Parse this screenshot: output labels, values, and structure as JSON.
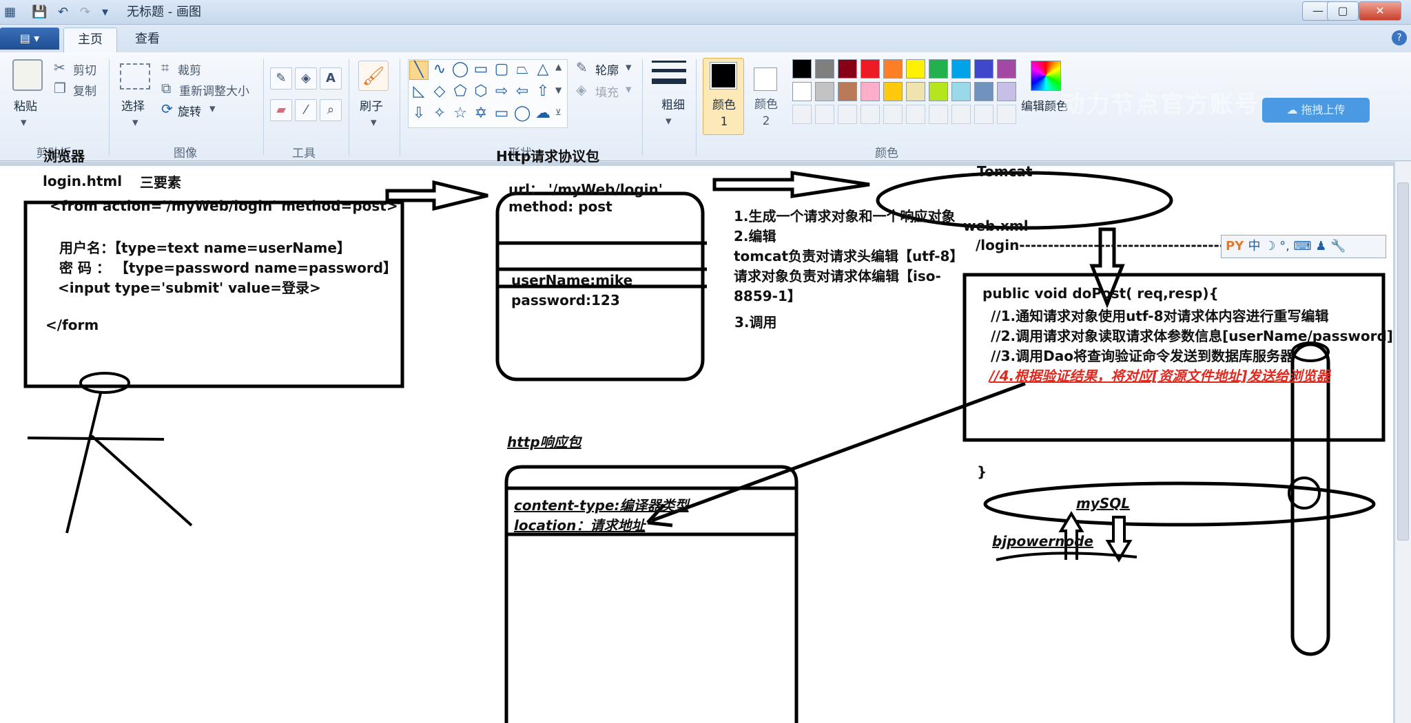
{
  "window": {
    "title": "无标题 - 画图",
    "buttons": {
      "minimize": "—",
      "maximize": "▢",
      "close": "✕"
    }
  },
  "quick_access": {
    "save": "💾",
    "undo": "↶",
    "redo": "↷",
    "customize": "▾"
  },
  "tabs": {
    "file": "▤ ▾",
    "home": "主页",
    "view": "查看",
    "help": "?"
  },
  "ribbon": {
    "clipboard": {
      "label": "剪贴板",
      "paste": "粘贴",
      "cut": "剪切",
      "copy": "复制"
    },
    "image": {
      "label": "图像",
      "select": "选择",
      "crop": "裁剪",
      "resize": "重新调整大小",
      "rotate": "旋转"
    },
    "tools": {
      "label": "工具"
    },
    "brush": {
      "label": "刷子"
    },
    "shapes": {
      "label": "形状",
      "outline": "轮廓",
      "fill": "填充"
    },
    "size": {
      "label": "粗细"
    },
    "colors": {
      "label": "颜色",
      "color1": "颜色 1",
      "color2": "颜色 2",
      "edit": "编辑颜色",
      "row1": [
        "#000000",
        "#7f7f7f",
        "#880015",
        "#ed1c24",
        "#ff7f27",
        "#fff200",
        "#22b14c",
        "#00a2e8",
        "#3f48cc",
        "#a349a4"
      ],
      "row2": [
        "#ffffff",
        "#c3c3c3",
        "#b97a57",
        "#ffaec9",
        "#ffc90e",
        "#efe4b0",
        "#b5e61d",
        "#99d9ea",
        "#7092be",
        "#c8bfe7"
      ]
    },
    "upload": "拖拽上传",
    "watermark": "动力节点官方账号"
  },
  "ime": "中 ☽ °, ⌨ ♟ 🔧",
  "canvas": {
    "browser_title": "浏览器",
    "login_html": "login.html",
    "three_elements": "三要素",
    "form_open": "<from action='/myWeb/login' method=post>",
    "username_field": "用户名：【type=text  name=userName】",
    "password_field": "密  码 ：  【type=password name=password】",
    "submit_field": "<input type='submit' value=登录>",
    "form_close": "</form",
    "http_request_title": "Http请求协议包",
    "req_url": "url：  '/myWeb/login'",
    "req_method": "method: post",
    "req_user": "userName:mike",
    "req_pass": "password:123",
    "step1": "1.生成一个请求对象和一个响应对象",
    "step2": "2.编辑",
    "step2a": "tomcat负责对请求头编辑【utf-8】",
    "step2b": "请求对象负责对请求体编辑【iso-",
    "step2c": "8859-1】",
    "step3": "3.调用",
    "tomcat": "Tomcat",
    "webxml": "web.xml",
    "mapping": "/login------------------------------------->LoginServlet",
    "do_post": "public  void doPost( req,resp){",
    "c1": "//1.通知请求对象使用utf-8对请求体内容进行重写编辑",
    "c2": "//2.调用请求对象读取请求体参数信息[userName/password]",
    "c3": "//3.调用Dao将查询验证命令发送到数据库服务器",
    "c4": "//4.根据验证结果，将对应[资源文件地址]发送给浏览器",
    "close_brace": "}",
    "http_response_title": "http响应包",
    "content_type": "content-type:编译器类型",
    "location": "location：请求地址",
    "mysql": "mySQL",
    "bjpowernode": "bjpowernode"
  }
}
